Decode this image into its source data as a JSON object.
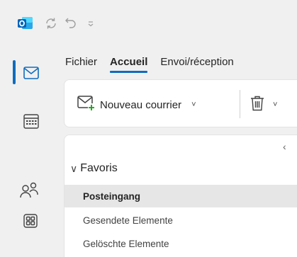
{
  "titlebar": {
    "app_icon": "outlook-logo",
    "sync_icon": "sync-icon",
    "undo_icon": "undo-icon",
    "qat_icon": "chevron-down-icon"
  },
  "rail": {
    "items": [
      {
        "name": "mail",
        "icon": "mail-icon",
        "active": true
      },
      {
        "name": "calendar",
        "icon": "calendar-icon",
        "active": false
      },
      {
        "name": "people",
        "icon": "people-icon",
        "active": false
      },
      {
        "name": "apps",
        "icon": "apps-icon",
        "active": false
      }
    ]
  },
  "ribbon": {
    "tabs": [
      {
        "label": "Fichier"
      },
      {
        "label": "Accueil",
        "active": true
      },
      {
        "label": "Envoi/réception"
      }
    ],
    "new_mail_label": "Nouveau courrier",
    "chevron": "˅",
    "delete_icon": "trash-icon"
  },
  "folders": {
    "collapse_glyph": "‹",
    "favorites_label": "Favoris",
    "favorites_chevron": "∨",
    "items": [
      {
        "label": "Posteingang",
        "selected": true
      },
      {
        "label": "Gesendete Elemente"
      },
      {
        "label": "Gelöschte Elemente"
      }
    ]
  },
  "colors": {
    "accent": "#0f6cbd",
    "outlook_blue": "#0364b8",
    "selected_bg": "#e6e6e6"
  }
}
